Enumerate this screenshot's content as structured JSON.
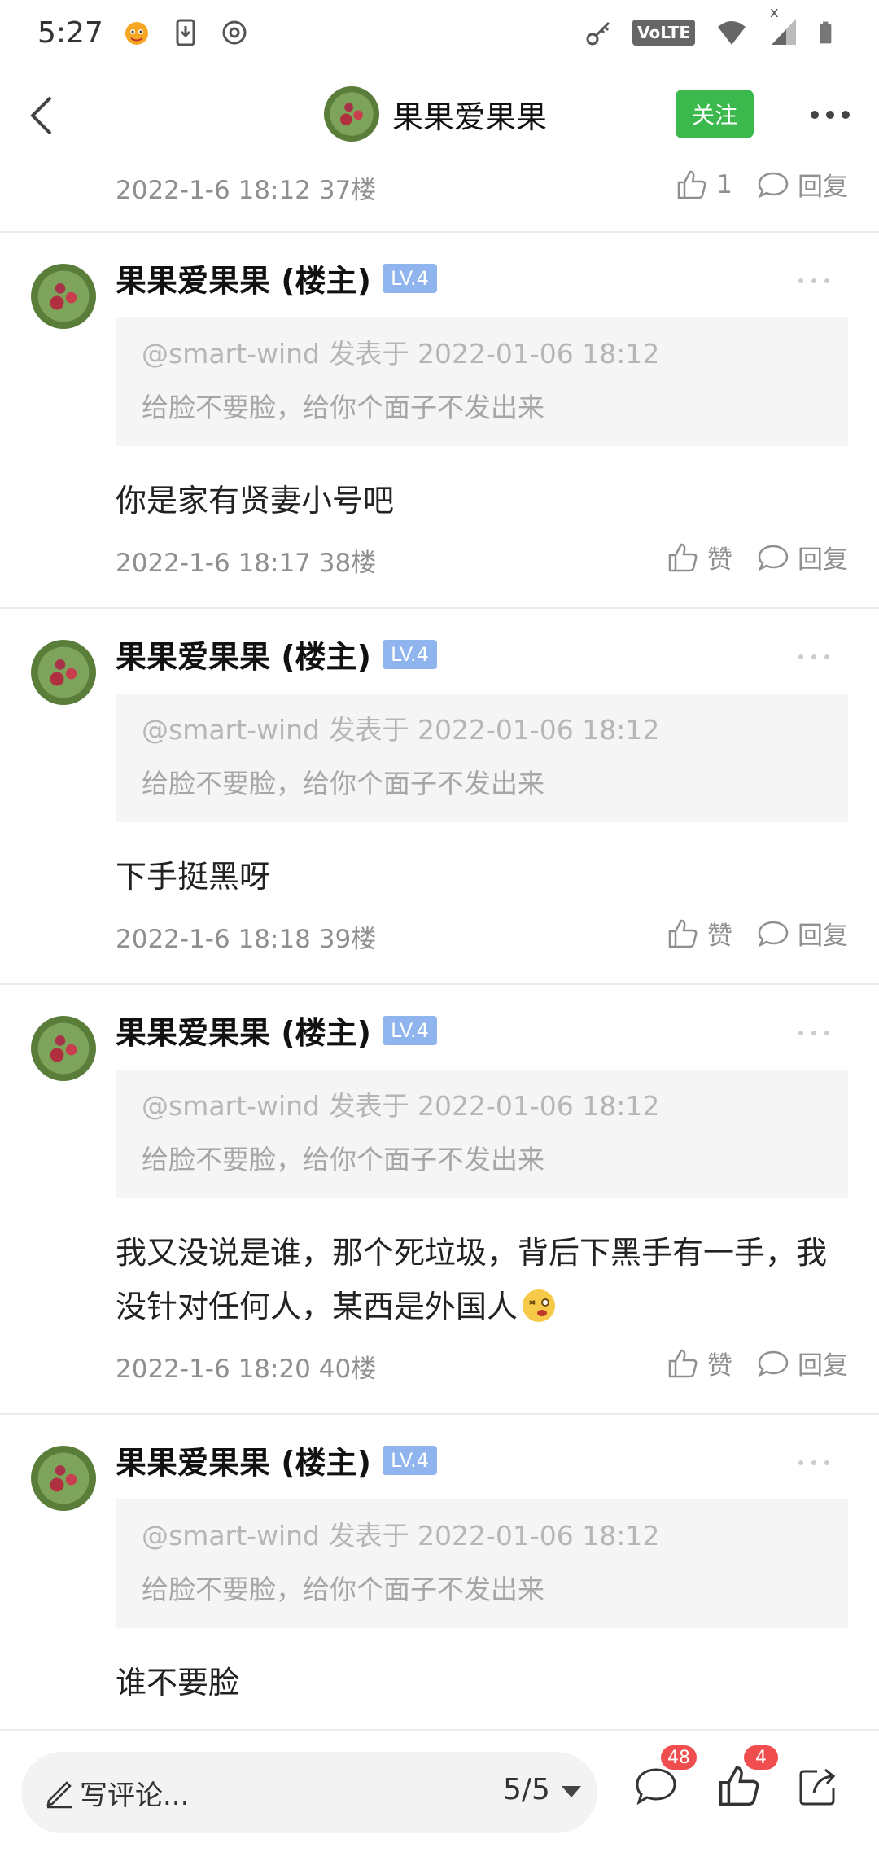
{
  "status_bar": {
    "time": "5:27",
    "volte": "VoLTE",
    "signal_x": "x"
  },
  "header": {
    "name": "果果爱果果",
    "follow_label": "关注"
  },
  "top_row": {
    "meta": "2022-1-6 18:12  37楼",
    "like_count": "1",
    "reply_label": "回复"
  },
  "comments": [
    {
      "name": "果果爱果果 (楼主)",
      "level": "LV.4",
      "quote_line1": "@smart-wind 发表于 2022-01-06 18:12",
      "quote_line2": "给脸不要脸，给你个面子不发出来",
      "body": "你是家有贤妻小号吧",
      "meta": "2022-1-6 18:17  38楼",
      "like_label": "赞",
      "reply_label": "回复"
    },
    {
      "name": "果果爱果果 (楼主)",
      "level": "LV.4",
      "quote_line1": "@smart-wind 发表于 2022-01-06 18:12",
      "quote_line2": "给脸不要脸，给你个面子不发出来",
      "body": "下手挺黑呀",
      "meta": "2022-1-6 18:18  39楼",
      "like_label": "赞",
      "reply_label": "回复"
    },
    {
      "name": "果果爱果果 (楼主)",
      "level": "LV.4",
      "quote_line1": "@smart-wind 发表于 2022-01-06 18:12",
      "quote_line2": "给脸不要脸，给你个面子不发出来",
      "body": "我又没说是谁，那个死垃圾，背后下黑手有一手，我没针对任何人，某西是外国人",
      "meta": "2022-1-6 18:20  40楼",
      "like_label": "赞",
      "reply_label": "回复"
    },
    {
      "name": "果果爱果果 (楼主)",
      "level": "LV.4",
      "quote_line1": "@smart-wind 发表于 2022-01-06 18:12",
      "quote_line2": "给脸不要脸，给你个面子不发出来",
      "body": "谁不要脸",
      "meta": "",
      "like_label": "",
      "reply_label": ""
    }
  ],
  "bottom_bar": {
    "placeholder": "写评论...",
    "page": "5/5",
    "comment_badge": "48",
    "like_badge": "4"
  },
  "colors": {
    "follow_green": "#3cb94d",
    "level_blue": "#8fb4ee",
    "badge_red": "#f04e4e",
    "meta_gray": "#8f8f8f"
  }
}
